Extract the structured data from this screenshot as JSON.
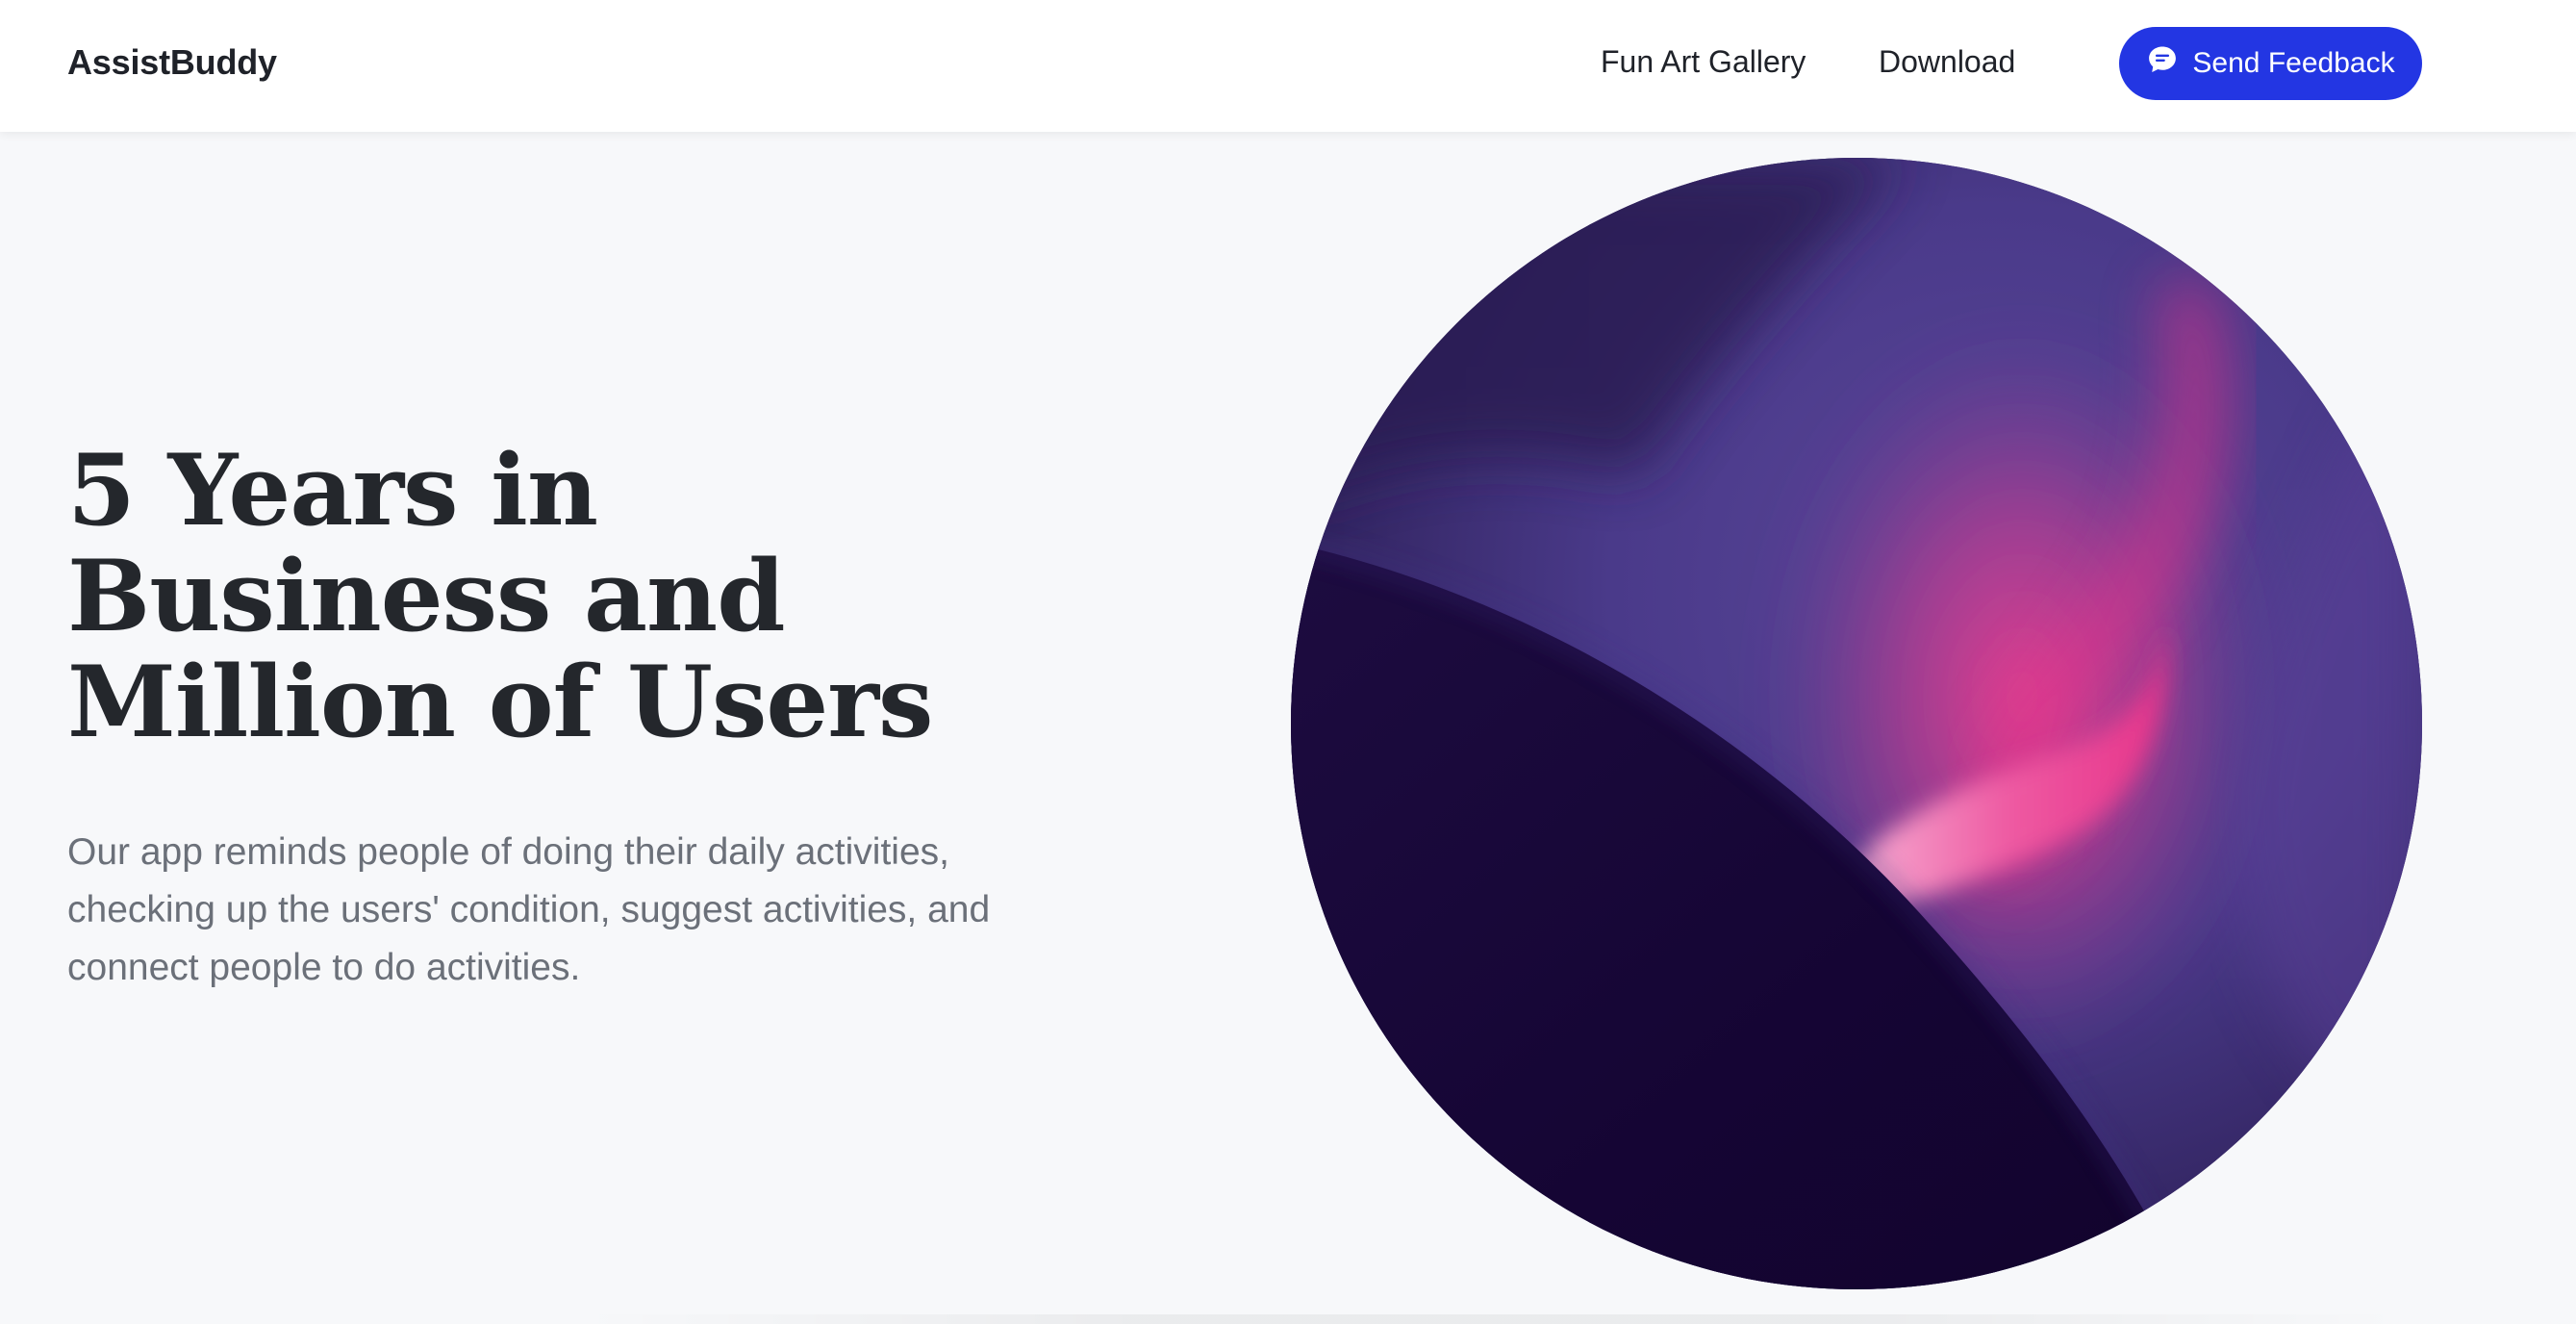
{
  "navbar": {
    "brand": "AssistBuddy",
    "links": [
      {
        "label": "Fun Art Gallery"
      },
      {
        "label": "Download"
      }
    ],
    "feedback_button": {
      "label": "Send Feedback",
      "icon": "chat-bubble-icon"
    }
  },
  "hero": {
    "title": "5 Years in Business and Million of Users",
    "description": "Our app reminds people of doing their daily activities, checking up the users' condition, suggest activities, and connect people to do activities.",
    "artwork": "abstract-gradient-art"
  },
  "colors": {
    "primary": "#2336e3",
    "heading": "#24272c",
    "body_text": "#6b7079",
    "background": "#f7f8fa",
    "art_dark": "#140532",
    "art_purple": "#4e3f8f",
    "art_pink": "#e7338a"
  }
}
